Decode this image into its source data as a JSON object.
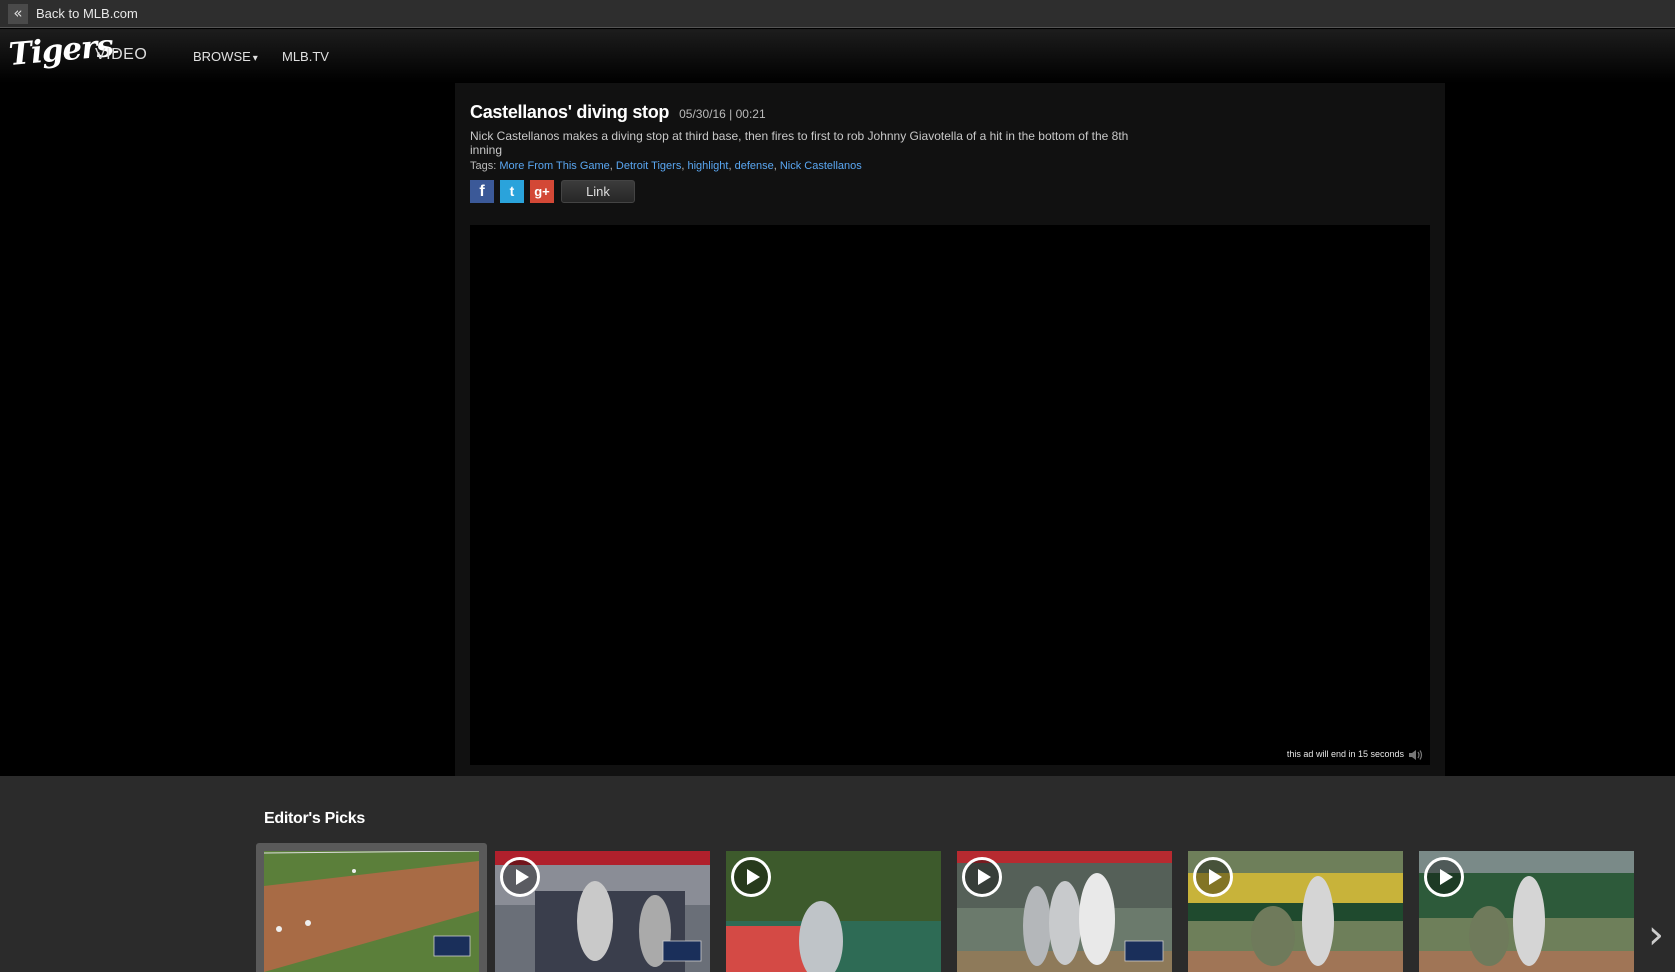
{
  "topbar": {
    "back_icon": "«",
    "back_label": "Back to MLB.com"
  },
  "nav": {
    "logo": "Tigers",
    "section": "VIDEO",
    "browse": "BROWSE",
    "browse_caret": "▾",
    "mlbtv": "MLB.TV"
  },
  "video": {
    "title": "Castellanos' diving stop",
    "meta": "05/30/16 | 00:21",
    "description": "Nick Castellanos makes a diving stop at third base, then fires to first to rob Johnny Giavotella of a hit in the bottom of the 8th inning",
    "tags_label": "Tags:",
    "tags": [
      "More From This Game",
      "Detroit Tigers",
      "highlight",
      "defense",
      "Nick Castellanos"
    ],
    "share": {
      "facebook": "f",
      "twitter": "t",
      "googleplus": "g+",
      "link": "Link"
    },
    "ad_note": "this ad will end in 15 seconds"
  },
  "picks": {
    "title": "Editor's Picks",
    "next_icon": "›",
    "thumbs": [
      {
        "name": "thumb-1",
        "active": true
      },
      {
        "name": "thumb-2",
        "active": false
      },
      {
        "name": "thumb-3",
        "active": false
      },
      {
        "name": "thumb-4",
        "active": false
      },
      {
        "name": "thumb-5",
        "active": false
      },
      {
        "name": "thumb-6",
        "active": false
      }
    ]
  },
  "colors": {
    "tag_link": "#5aa7f2",
    "facebook": "#3b5998",
    "twitter": "#2aa3db",
    "googleplus": "#d34836"
  }
}
